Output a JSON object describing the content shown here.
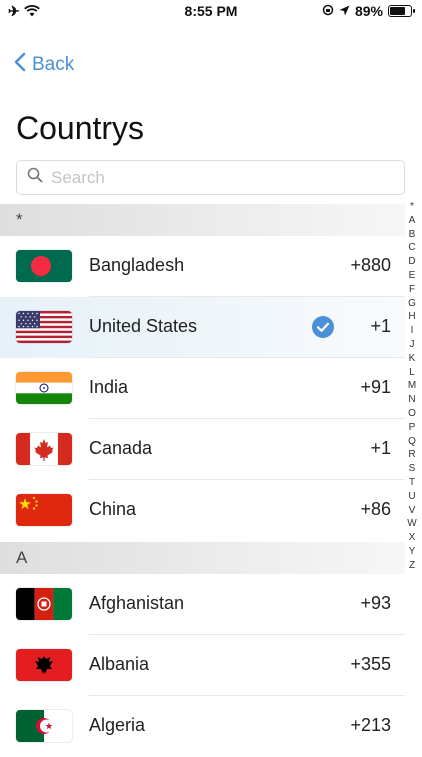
{
  "status_bar": {
    "time": "8:55 PM",
    "battery_percent": "89%",
    "battery_level": 0.89,
    "left_icons": [
      "airplane-icon",
      "wifi-icon"
    ],
    "right_icons": [
      "rotation-lock-icon",
      "location-arrow-icon",
      "battery-icon"
    ]
  },
  "nav": {
    "back_label": "Back"
  },
  "page_title": "Countrys",
  "search": {
    "placeholder": "Search",
    "value": ""
  },
  "accent_color": "#4a90d9",
  "sections": [
    {
      "header": "*",
      "countries": [
        {
          "name": "Bangladesh",
          "code": "+880",
          "flag": "bangladesh-flag-icon",
          "selected": false
        },
        {
          "name": "United States",
          "code": "+1",
          "flag": "united-states-flag-icon",
          "selected": true
        },
        {
          "name": "India",
          "code": "+91",
          "flag": "india-flag-icon",
          "selected": false
        },
        {
          "name": "Canada",
          "code": "+1",
          "flag": "canada-flag-icon",
          "selected": false
        },
        {
          "name": "China",
          "code": "+86",
          "flag": "china-flag-icon",
          "selected": false
        }
      ]
    },
    {
      "header": "A",
      "countries": [
        {
          "name": "Afghanistan",
          "code": "+93",
          "flag": "afghanistan-flag-icon",
          "selected": false
        },
        {
          "name": "Albania",
          "code": "+355",
          "flag": "albania-flag-icon",
          "selected": false
        },
        {
          "name": "Algeria",
          "code": "+213",
          "flag": "algeria-flag-icon",
          "selected": false
        }
      ]
    }
  ],
  "index_letters": [
    "*",
    "A",
    "B",
    "C",
    "D",
    "E",
    "F",
    "G",
    "H",
    "I",
    "J",
    "K",
    "L",
    "M",
    "N",
    "O",
    "P",
    "Q",
    "R",
    "S",
    "T",
    "U",
    "V",
    "W",
    "X",
    "Y",
    "Z"
  ]
}
